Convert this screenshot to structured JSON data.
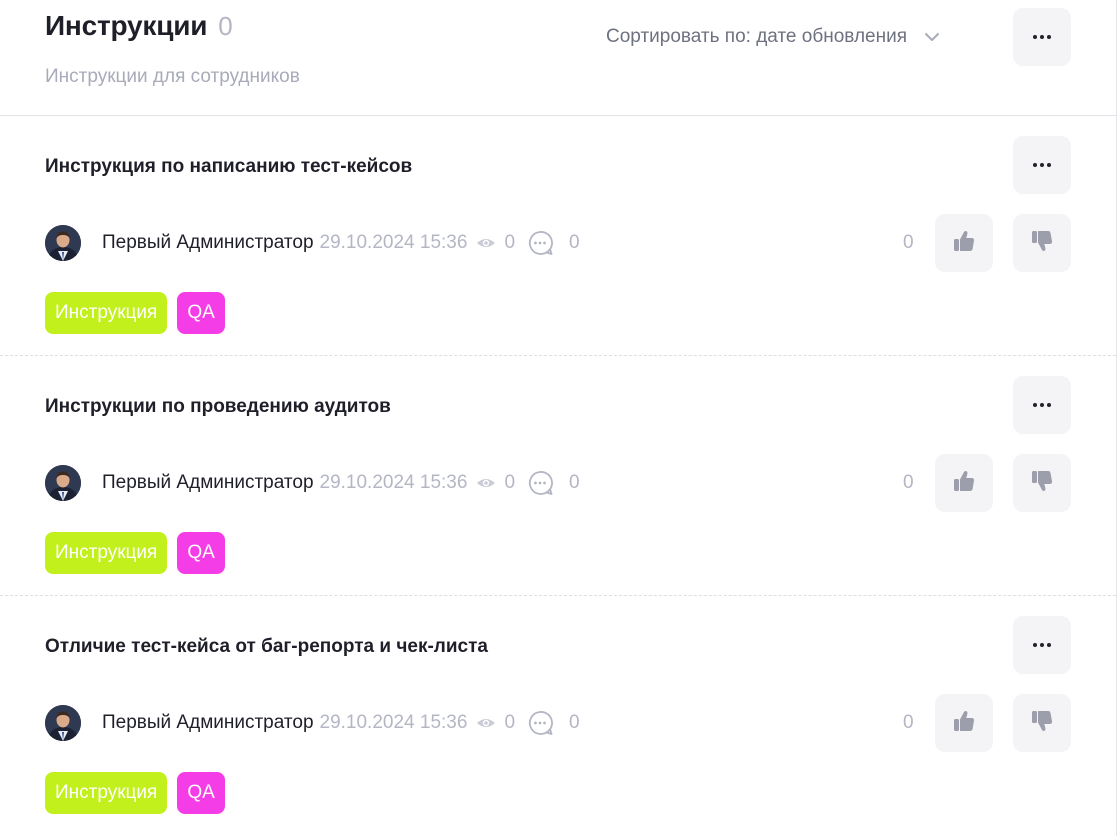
{
  "header": {
    "title": "Инструкции",
    "count": "0",
    "subtitle": "Инструкции для сотрудников",
    "sort_label": "Сортировать по: дате обновления"
  },
  "colors": {
    "tag_instruction": "#c2f01c",
    "tag_qa": "#f53de7",
    "button_bg": "#f4f4f7",
    "muted_text": "#b4b6c4"
  },
  "icons": [
    "more-dots-icon",
    "chevron-down-icon",
    "eye-icon",
    "comment-icon",
    "thumbs-up-icon",
    "thumbs-down-icon"
  ],
  "items": [
    {
      "title": "Инструкция по написанию тест-кейсов",
      "author": "Первый Администратор",
      "date": "29.10.2024 15:36",
      "views": "0",
      "comments": "0",
      "rating": "0",
      "tags": [
        "Инструкция",
        "QA"
      ]
    },
    {
      "title": "Инструкции по проведению аудитов",
      "author": "Первый Администратор",
      "date": "29.10.2024 15:36",
      "views": "0",
      "comments": "0",
      "rating": "0",
      "tags": [
        "Инструкция",
        "QA"
      ]
    },
    {
      "title": "Отличие тест-кейса от баг-репорта и чек-листа",
      "author": "Первый Администратор",
      "date": "29.10.2024 15:36",
      "views": "0",
      "comments": "0",
      "rating": "0",
      "tags": [
        "Инструкция",
        "QA"
      ]
    }
  ]
}
